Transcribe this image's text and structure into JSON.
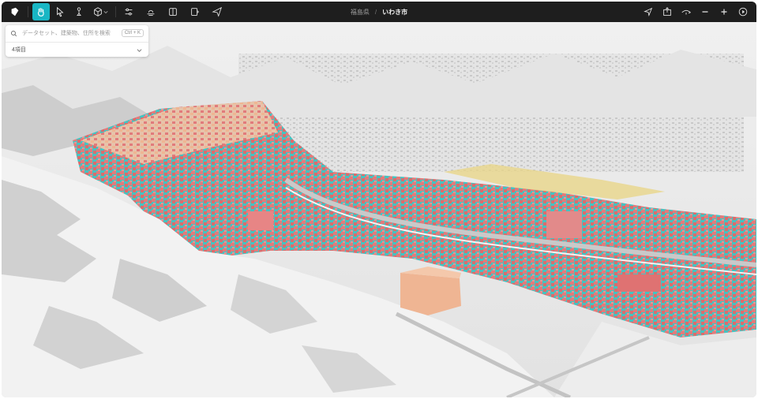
{
  "breadcrumb": {
    "prefecture": "福島県",
    "city": "いわき市"
  },
  "search": {
    "placeholder": "データセット、建築物、住所を検索",
    "shortcut": "Ctrl + K"
  },
  "datasets": {
    "count_label": "4項目"
  },
  "toolbar_left": [
    {
      "icon": "logo-icon"
    },
    {
      "icon": "hand-icon",
      "active": true
    },
    {
      "icon": "select-pointer-icon"
    },
    {
      "icon": "pedestrian-icon"
    },
    {
      "icon": "cube-icon"
    },
    {
      "icon": "sliders-icon"
    },
    {
      "icon": "sun-horizon-icon"
    },
    {
      "icon": "split-view-icon"
    },
    {
      "icon": "story-icon"
    },
    {
      "icon": "share-icon"
    }
  ],
  "toolbar_right": [
    {
      "icon": "locate-icon"
    },
    {
      "icon": "export-icon"
    },
    {
      "icon": "orbit-icon"
    },
    {
      "icon": "zoom-out-icon"
    },
    {
      "icon": "zoom-in-icon"
    },
    {
      "icon": "play-icon"
    }
  ],
  "colors": {
    "accent": "#19b6c4",
    "toolbar_bg": "#1e1e1e",
    "terrain": "#e9e9e9",
    "buildings_residential": "#e27b7b",
    "buildings_commercial": "#efb593",
    "buildings_industrial": "#e8d68a",
    "flood_area": "#43c1c0"
  }
}
